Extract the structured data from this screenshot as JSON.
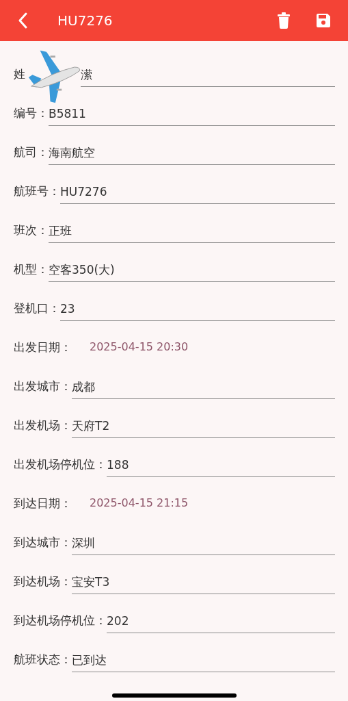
{
  "header": {
    "title": "HU7276"
  },
  "fields": [
    {
      "kind": "covered",
      "label": "姓",
      "value": "潆"
    },
    {
      "kind": "text",
      "label": "编号：",
      "value": "B5811"
    },
    {
      "kind": "text",
      "label": "航司：",
      "value": "海南航空"
    },
    {
      "kind": "text",
      "label": "航班号：",
      "value": "HU7276"
    },
    {
      "kind": "text",
      "label": "班次：",
      "value": "正班"
    },
    {
      "kind": "text",
      "label": "机型：",
      "value": "空客350(大)"
    },
    {
      "kind": "text",
      "label": "登机口：",
      "value": "23"
    },
    {
      "kind": "date",
      "label": "出发日期：",
      "value": "2025-04-15 20:30"
    },
    {
      "kind": "text",
      "label": "出发城市：",
      "value": "成都"
    },
    {
      "kind": "text",
      "label": "出发机场：",
      "value": "天府T2"
    },
    {
      "kind": "text",
      "label": "出发机场停机位：",
      "value": "188"
    },
    {
      "kind": "date",
      "label": "到达日期：",
      "value": "2025-04-15 21:15"
    },
    {
      "kind": "text",
      "label": "到达城市：",
      "value": "深圳"
    },
    {
      "kind": "text",
      "label": "到达机场：",
      "value": "宝安T3"
    },
    {
      "kind": "text",
      "label": "到达机场停机位：",
      "value": "202"
    },
    {
      "kind": "text",
      "label": "航班状态：",
      "value": "已到达"
    }
  ]
}
